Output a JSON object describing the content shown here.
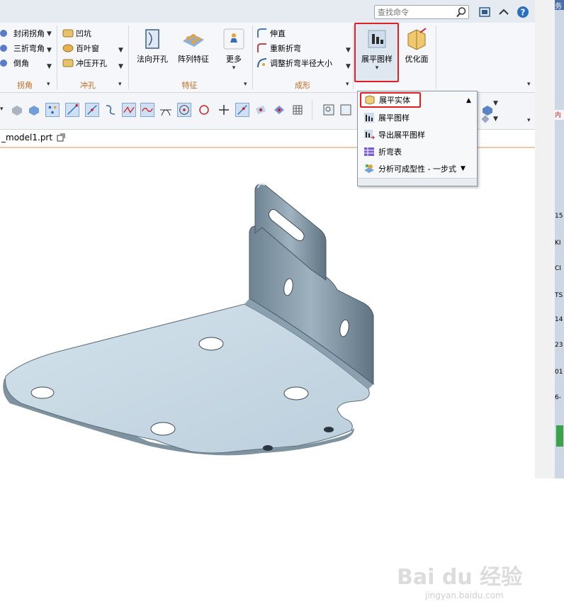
{
  "search": {
    "placeholder": "查找命令"
  },
  "ribbon": {
    "col1": [
      "封闭拐角",
      "三折弯角",
      "倒角"
    ],
    "col2": [
      "凹坑",
      "百叶窗",
      "冲压开孔"
    ],
    "feature_buttons": [
      "法向开孔",
      "阵列特征",
      "更多"
    ],
    "col4": [
      "伸直",
      "重新折弯",
      "调整折弯半径大小"
    ],
    "flat_pattern_button": "展平图样",
    "optimize_button": "优化面",
    "groups": [
      "拐角",
      "冲孔",
      "特征",
      "成形"
    ]
  },
  "file_tab": {
    "name": "_model1.prt"
  },
  "dropdown": {
    "items": [
      "展平实体",
      "展平图样",
      "导出展平图样",
      "折弯表",
      "分析可成型性 - 一步式"
    ]
  },
  "side_strip": {
    "chars": [
      "务",
      "15",
      "KI",
      "CI",
      "TS",
      "14",
      "23",
      "01",
      "6-"
    ]
  },
  "watermark": {
    "logo": "Bai du 经验",
    "url": "jingyan.baidu.com"
  },
  "colors": {
    "highlight": "#e02020",
    "part_surface": "#c5d8e4",
    "group_label": "#c46a1d"
  }
}
